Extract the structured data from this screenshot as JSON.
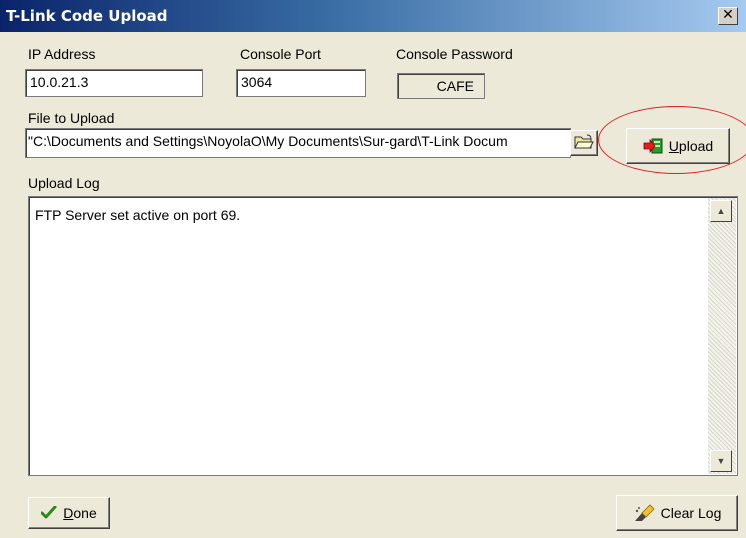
{
  "window": {
    "title": "T-Link Code Upload",
    "close_symbol": "✕"
  },
  "fields": {
    "ip_address": {
      "label": "IP Address",
      "value": "10.0.21.3"
    },
    "console_port": {
      "label": "Console Port",
      "value": "3064"
    },
    "console_password": {
      "label": "Console Password",
      "value": "CAFE"
    },
    "file_to_upload": {
      "label": "File to Upload",
      "value": "\"C:\\Documents and Settings\\NoyolaO\\My Documents\\Sur-gard\\T-Link Docum"
    }
  },
  "buttons": {
    "upload": {
      "label_first": "U",
      "label_rest": "pload"
    },
    "done": {
      "label_first": "D",
      "label_rest": "one"
    },
    "clear_log": {
      "label_main": "Clear Lo",
      "label_last": "g"
    }
  },
  "upload_log": {
    "label": "Upload Log",
    "lines": [
      "FTP Server set active on port 69."
    ]
  },
  "icons": {
    "browse": "folder-open-icon",
    "upload": "upload-arrow-icon",
    "done": "checkmark-icon",
    "clear_log": "eraser-icon"
  },
  "colors": {
    "title_gradient_start": "#0a246a",
    "title_gradient_end": "#a6caf0",
    "highlight": "#e02020",
    "check_green": "#2a8a1a"
  }
}
